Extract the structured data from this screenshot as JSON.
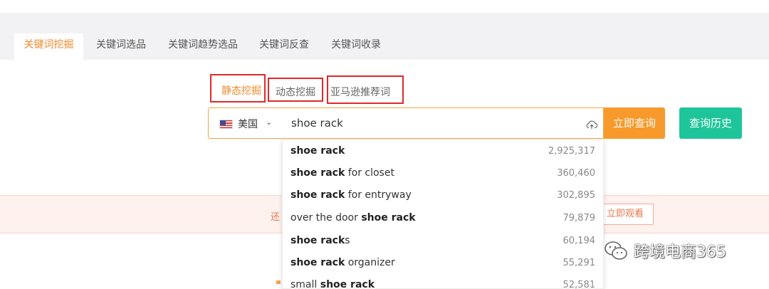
{
  "tabs": [
    {
      "label": "关键词挖掘",
      "active": true
    },
    {
      "label": "关键词选品",
      "active": false
    },
    {
      "label": "关键词趋势选品",
      "active": false
    },
    {
      "label": "关键词反查",
      "active": false
    },
    {
      "label": "关键词收录",
      "active": false
    }
  ],
  "subtabs": [
    {
      "label": "静态挖掘",
      "active": true
    },
    {
      "label": "动态挖掘",
      "active": false
    },
    {
      "label": "亚马逊推荐词",
      "active": false
    }
  ],
  "search": {
    "country": "美国",
    "query": "shoe rack",
    "submit_label": "立即查询",
    "history_label": "查询历史"
  },
  "suggestions": [
    {
      "pre": "",
      "bold": "shoe rack",
      "post": "",
      "count": "2,925,317"
    },
    {
      "pre": "",
      "bold": "shoe rack",
      "post": " for closet",
      "count": "360,460"
    },
    {
      "pre": "",
      "bold": "shoe rack",
      "post": " for entryway",
      "count": "302,895"
    },
    {
      "pre": "over the door ",
      "bold": "shoe rack",
      "post": "",
      "count": "79,879"
    },
    {
      "pre": "",
      "bold": "shoe rack",
      "post": "s",
      "count": "60,194"
    },
    {
      "pre": "",
      "bold": "shoe rack",
      "post": " organizer",
      "count": "55,291"
    },
    {
      "pre": "small ",
      "bold": "shoe rack",
      "post": "",
      "count": "52,581"
    }
  ],
  "banner": {
    "left_text": "还",
    "button_label": "立即观看"
  },
  "watermark": {
    "text": "跨境电商365"
  },
  "colors": {
    "accent": "#f79a2b",
    "green": "#1fc59a",
    "highlight_border": "#e0282a"
  }
}
